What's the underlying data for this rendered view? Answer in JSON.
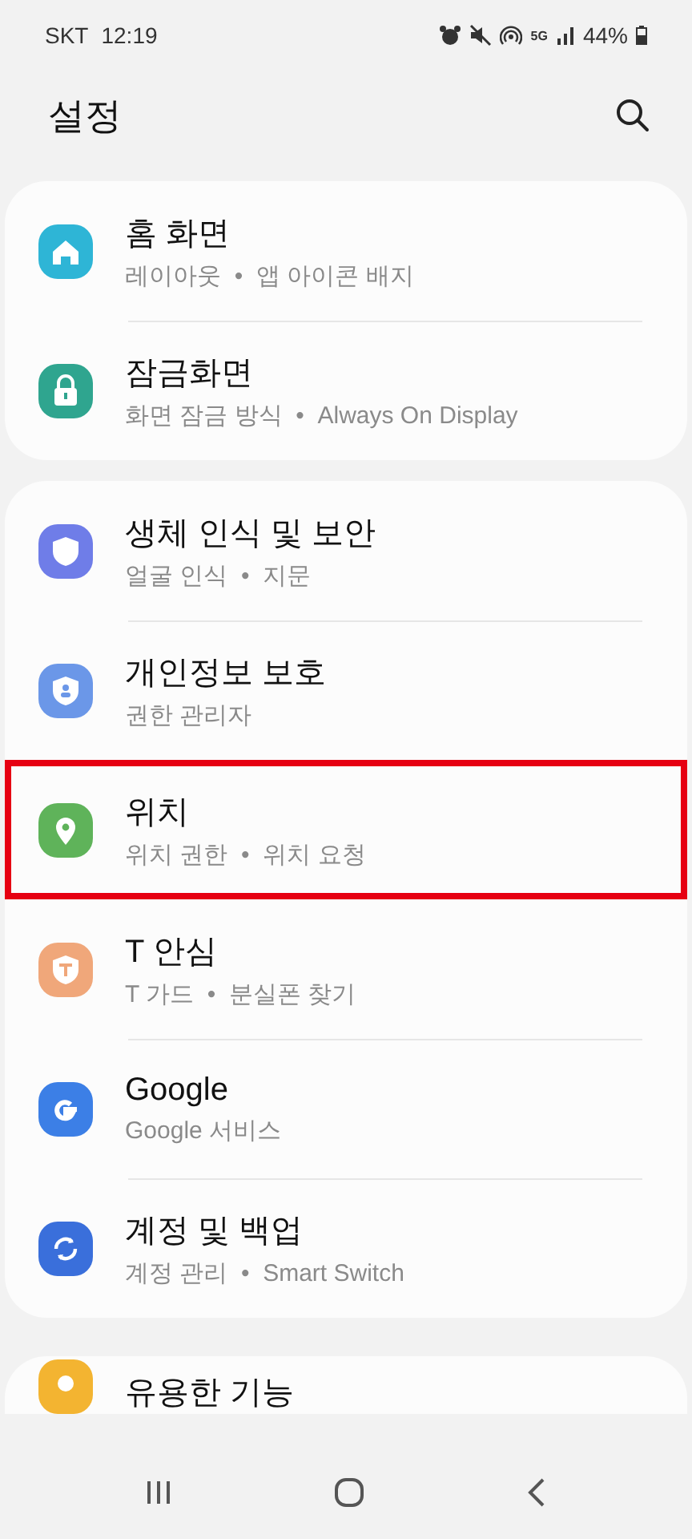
{
  "status_bar": {
    "carrier": "SKT",
    "time": "12:19",
    "network": "5G",
    "battery": "44%"
  },
  "header": {
    "title": "설정"
  },
  "groups": [
    {
      "items": [
        {
          "kind": "home",
          "color": "#2eb5d6",
          "title": "홈 화면",
          "subtitle": "레이아웃  •  앱 아이콘 배지",
          "highlighted": false
        },
        {
          "kind": "lock",
          "color": "#2fa58f",
          "title": "잠금화면",
          "subtitle": "화면 잠금 방식  •  Always On Display",
          "highlighted": false
        }
      ]
    },
    {
      "items": [
        {
          "kind": "shield",
          "color": "#6f7de8",
          "title": "생체 인식 및 보안",
          "subtitle": "얼굴 인식  •  지문",
          "highlighted": false
        },
        {
          "kind": "privacy",
          "color": "#6b97e8",
          "title": "개인정보 보호",
          "subtitle": "권한 관리자",
          "highlighted": false
        },
        {
          "kind": "location",
          "color": "#5fb35a",
          "title": "위치",
          "subtitle": "위치 권한  •  위치 요청",
          "highlighted": true
        },
        {
          "kind": "tguard",
          "color": "#f0a77a",
          "title": "T 안심",
          "subtitle": "T 가드  •  분실폰 찾기",
          "highlighted": false
        },
        {
          "kind": "google",
          "color": "#3c7fe6",
          "title": "Google",
          "subtitle": "Google 서비스",
          "highlighted": false
        },
        {
          "kind": "sync",
          "color": "#3a6fdb",
          "title": "계정 및 백업",
          "subtitle": "계정 관리  •  Smart Switch",
          "highlighted": false
        }
      ]
    },
    {
      "items": [
        {
          "kind": "bulb",
          "color": "#f3b431",
          "title": "유용한 기능",
          "highlighted": false
        }
      ]
    }
  ]
}
